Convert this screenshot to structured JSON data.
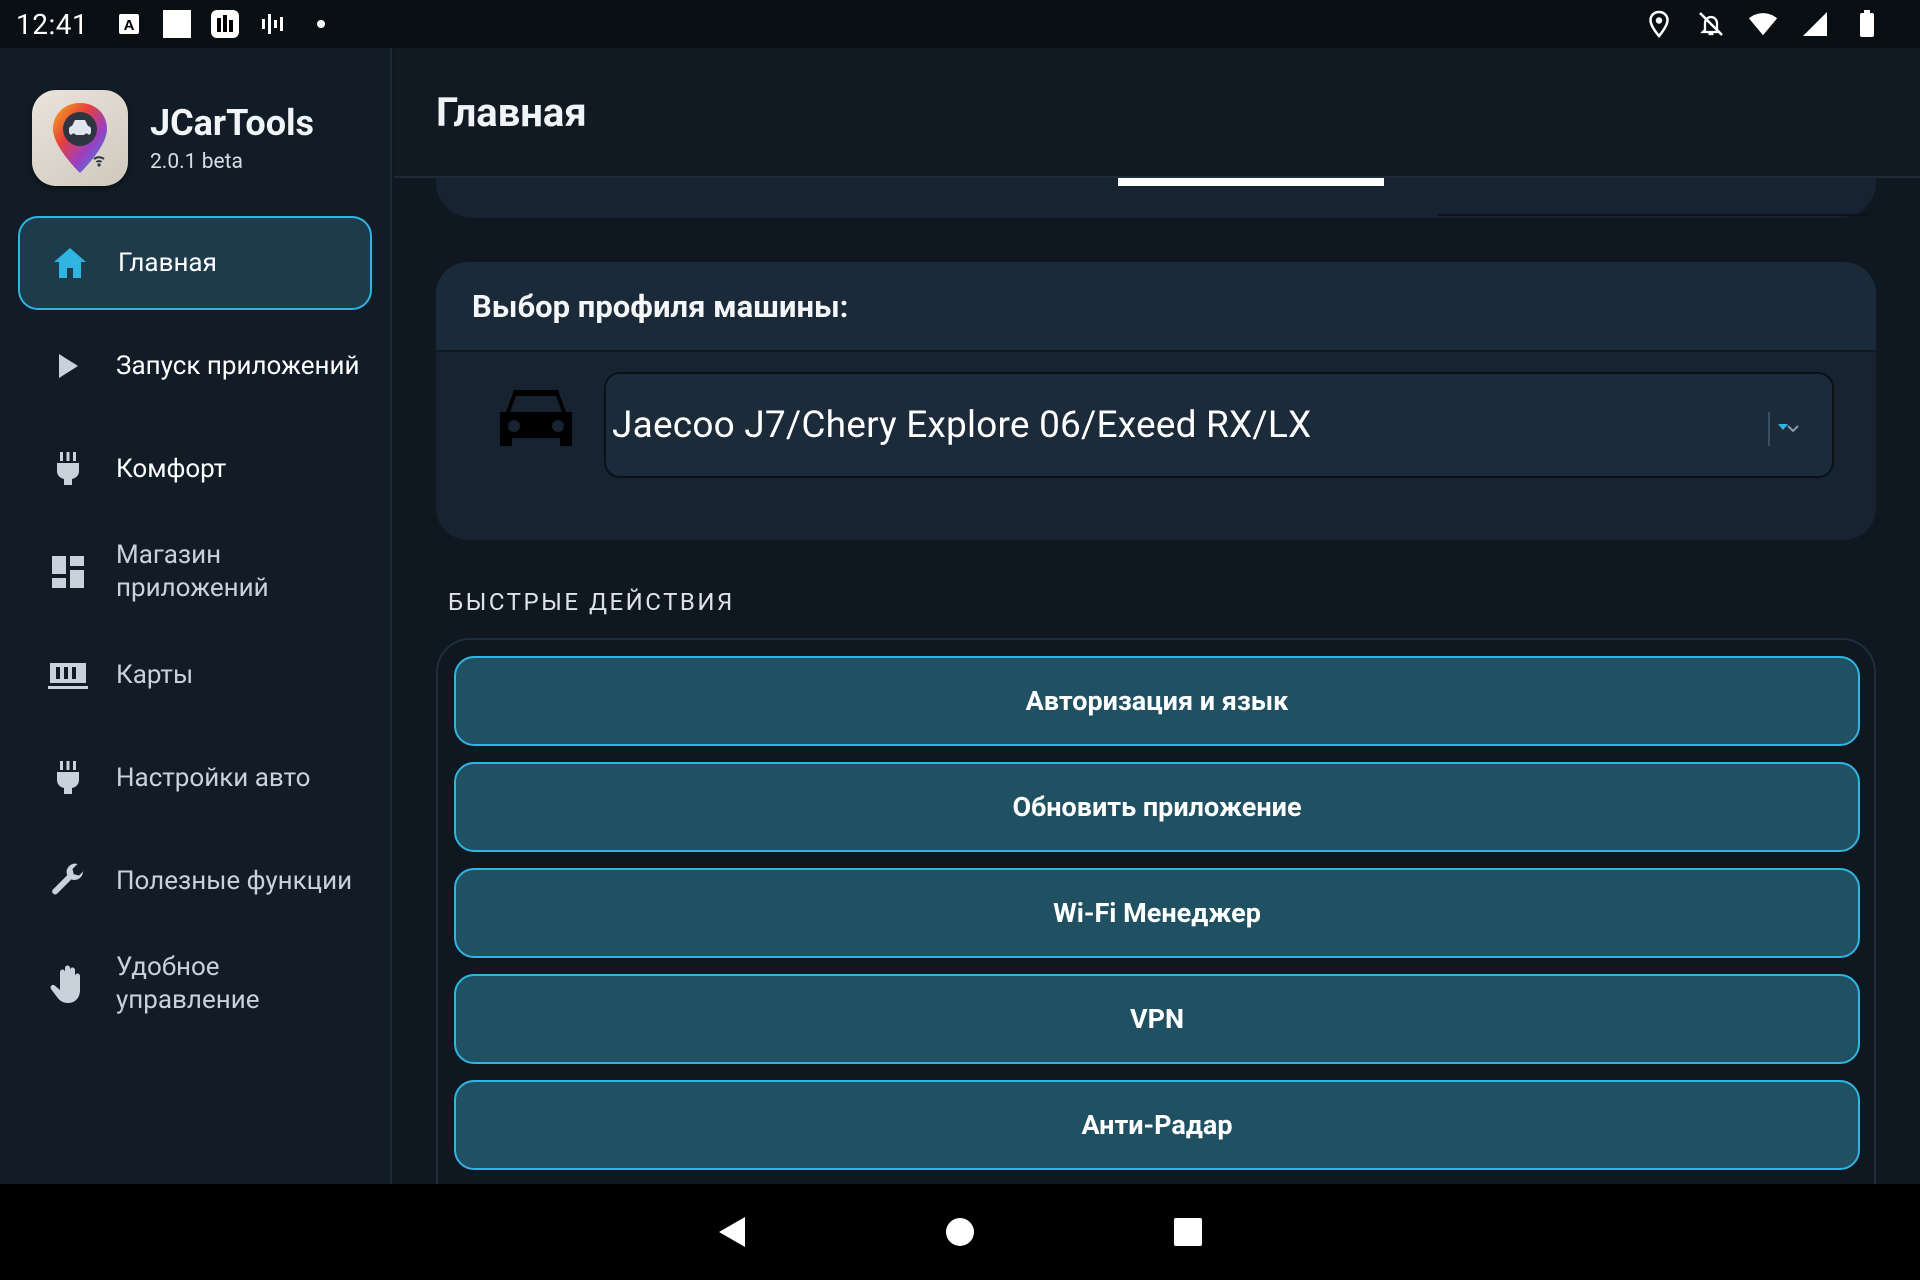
{
  "status_bar": {
    "time": "12:41",
    "left_icons": [
      "keyboard-a-icon",
      "white-square-icon",
      "gallery-icon",
      "waveform-icon",
      "dot-icon"
    ],
    "right_icons": [
      "location-icon",
      "notifications-off-icon",
      "wifi-icon",
      "signal-icon",
      "battery-icon"
    ]
  },
  "app": {
    "name": "JCarTools",
    "version": "2.0.1 beta"
  },
  "sidebar": {
    "items": [
      {
        "label": "Главная",
        "icon": "home-icon",
        "active": true
      },
      {
        "label": "Запуск приложений",
        "icon": "play-icon",
        "active": false
      },
      {
        "label": "Комфорт",
        "icon": "plug-icon",
        "active": false
      },
      {
        "label": "Магазин\nприложений",
        "icon": "dashboard-icon",
        "active": false
      },
      {
        "label": "Карты",
        "icon": "map-grid-icon",
        "active": false
      },
      {
        "label": "Настройки авто",
        "icon": "plug-icon",
        "active": false
      },
      {
        "label": "Полезные функции",
        "icon": "wrench-icon",
        "active": false
      },
      {
        "label": "Удобное\nуправление",
        "icon": "hand-icon",
        "active": false
      }
    ]
  },
  "main": {
    "title": "Главная",
    "profile": {
      "heading": "Выбор профиля машины:",
      "selected": "Jaecoo J7/Chery Explore 06/Exeed RX/LX",
      "icon": "car-icon"
    },
    "quick_actions": {
      "label": "БЫСТРЫЕ ДЕЙСТВИЯ",
      "buttons": [
        "Авторизация и язык",
        "Обновить приложение",
        "Wi-Fi Менеджер",
        "VPN",
        "Анти-Радар"
      ]
    }
  },
  "nav_bar": {
    "buttons": [
      "back-icon",
      "home-circle-icon",
      "recents-icon"
    ]
  },
  "colors": {
    "accent": "#2fb5e0",
    "button_fill": "#1f5163",
    "active_nav": "#1e3b4c",
    "background": "#0f1720"
  }
}
